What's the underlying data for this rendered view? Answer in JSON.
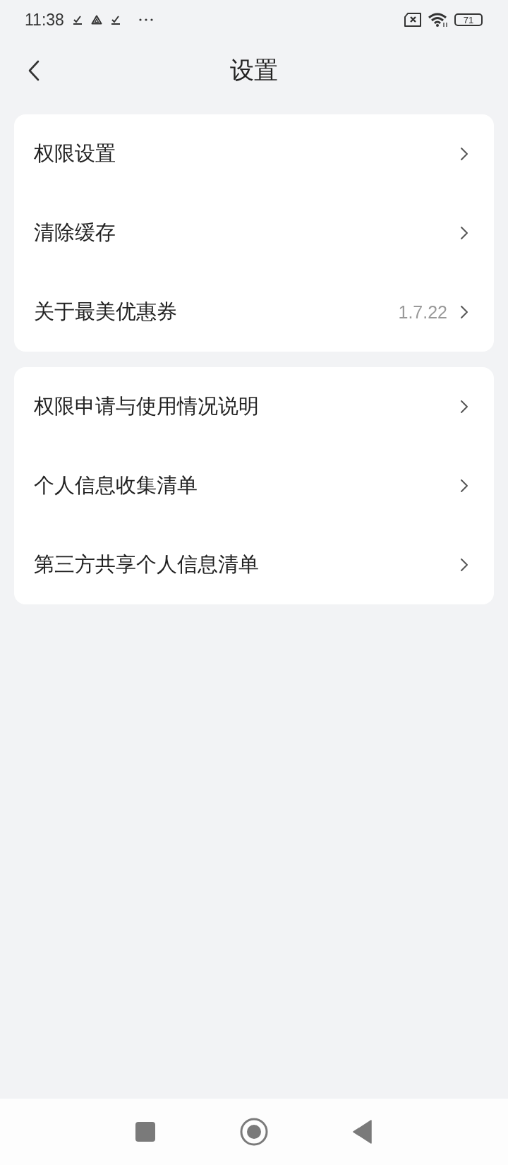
{
  "status_bar": {
    "time": "11:38",
    "battery": "71"
  },
  "header": {
    "title": "设置"
  },
  "groups": [
    {
      "items": [
        {
          "label": "权限设置"
        },
        {
          "label": "清除缓存"
        },
        {
          "label": "关于最美优惠券",
          "detail": "1.7.22"
        }
      ]
    },
    {
      "items": [
        {
          "label": "权限申请与使用情况说明"
        },
        {
          "label": "个人信息收集清单"
        },
        {
          "label": "第三方共享个人信息清单"
        }
      ]
    }
  ]
}
